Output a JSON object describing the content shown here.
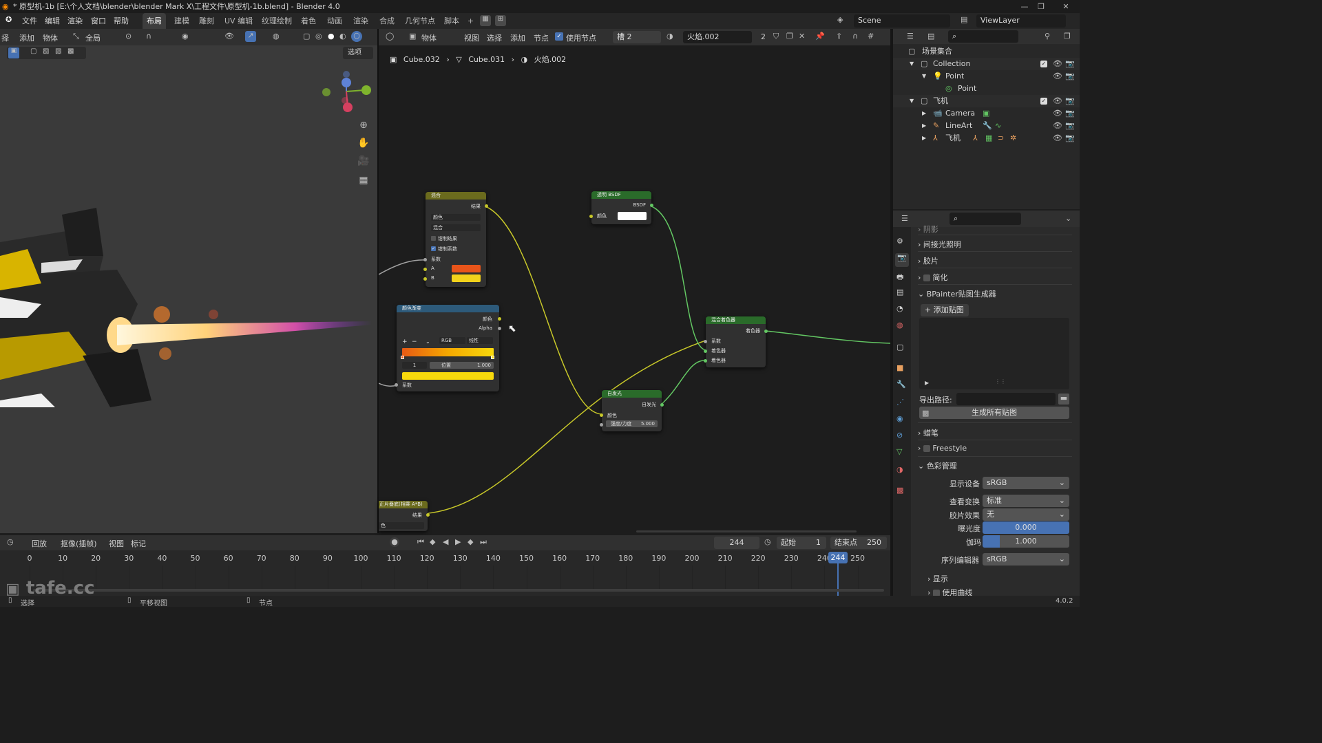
{
  "window": {
    "title": "* 原型机-1b [E:\\个人文档\\blender\\blender Mark X\\工程文件\\原型机-1b.blend] - Blender 4.0"
  },
  "menu": [
    "文件",
    "编辑",
    "渲染",
    "窗口",
    "帮助"
  ],
  "workspaces": [
    "布局",
    "建模",
    "雕刻",
    "UV 编辑",
    "纹理绘制",
    "着色",
    "动画",
    "渲染",
    "合成",
    "几何节点",
    "脚本"
  ],
  "active_workspace": "布局",
  "scene": {
    "label": "Scene",
    "view_layer": "ViewLayer"
  },
  "viewport": {
    "menu": [
      "择",
      "添加",
      "物体"
    ],
    "orientation": "全局",
    "options": "选项"
  },
  "node_editor": {
    "header": {
      "type": "物体",
      "menus": [
        "视图",
        "选择",
        "添加",
        "节点"
      ],
      "use_nodes": "使用节点",
      "slot": "槽 2",
      "material": "火焰.002",
      "users": "2"
    },
    "breadcrumb": [
      "Cube.032",
      "Cube.031",
      "火焰.002"
    ],
    "nodes": {
      "mix": {
        "title": "混合",
        "output": "结果",
        "dropdown1": "颜色",
        "dropdown2": "混合",
        "clamp_result": "钳制结果",
        "clamp_factor": "钳制系数",
        "factor": "系数",
        "a": "A",
        "b": "B",
        "color_a": "#e8541a",
        "color_b": "#f2d21b"
      },
      "colorramp": {
        "title": "颜色渐变",
        "out_color": "颜色",
        "out_alpha": "Alpha",
        "mode": "RGB",
        "interp": "线性",
        "index": "1",
        "pos_label": "位置",
        "pos_value": "1.000",
        "factor": "系数"
      },
      "transparent": {
        "title": "透明 BSDF",
        "output": "BSDF",
        "color": "颜色"
      },
      "mix_shader": {
        "title": "混合着色器",
        "output": "着色器",
        "factor": "系数",
        "shader1": "着色器",
        "shader2": "着色器"
      },
      "emission": {
        "title": "自发光",
        "output": "自发光",
        "color": "颜色",
        "strength_label": "强度/力度",
        "strength_value": "5.000"
      },
      "math": {
        "title": "正片叠底(相乘 A*B)",
        "output": "结果",
        "dropdown": "色"
      }
    }
  },
  "outliner": {
    "root": "场景集合",
    "rows": [
      {
        "label": "Collection",
        "indent": 1
      },
      {
        "label": "Point",
        "indent": 2
      },
      {
        "label": "Point",
        "indent": 3
      },
      {
        "label": "飞机",
        "indent": 1
      },
      {
        "label": "Camera",
        "indent": 2
      },
      {
        "label": "LineArt",
        "indent": 2
      },
      {
        "label": "飞机",
        "indent": 2
      }
    ]
  },
  "properties": {
    "panels_top": [
      "阴影",
      "间接光照明",
      "胶片",
      "简化",
      "BPainter贴图生成器"
    ],
    "add_texture": "添加贴图",
    "export_path_label": "导出路径:",
    "generate_all": "生成所有贴图",
    "grease_pencil": "蜡笔",
    "freestyle": "Freestyle",
    "color_management": "色彩管理",
    "display_device_label": "显示设备",
    "display_device": "sRGB",
    "view_transform_label": "查看变换",
    "view_transform": "标准",
    "look_label": "胶片效果",
    "look": "无",
    "exposure_label": "曝光度",
    "exposure": "0.000",
    "gamma_label": "伽玛",
    "gamma": "1.000",
    "sequencer_label": "序列编辑器",
    "sequencer": "sRGB",
    "display": "显示",
    "use_curves": "使用曲线"
  },
  "timeline": {
    "menus": [
      "回放",
      "抠像(插帧)",
      "视图",
      "标记"
    ],
    "current_frame": "244",
    "start_label": "起始",
    "start": "1",
    "end_label": "结束点",
    "end": "250",
    "ticks": [
      "0",
      "10",
      "20",
      "30",
      "40",
      "50",
      "60",
      "70",
      "80",
      "90",
      "100",
      "110",
      "120",
      "130",
      "140",
      "150",
      "160",
      "170",
      "180",
      "190",
      "200",
      "210",
      "220",
      "230",
      "240",
      "250"
    ],
    "playhead_label": "244"
  },
  "statusbar": {
    "select": "选择",
    "pan": "平移视图",
    "node": "节点",
    "version": "4.0.2"
  },
  "watermark": "tafe.cc",
  "colors": {
    "accent_blue": "#4772b3",
    "shader_green": "#63c763",
    "float_yellow": "#c7c729"
  }
}
